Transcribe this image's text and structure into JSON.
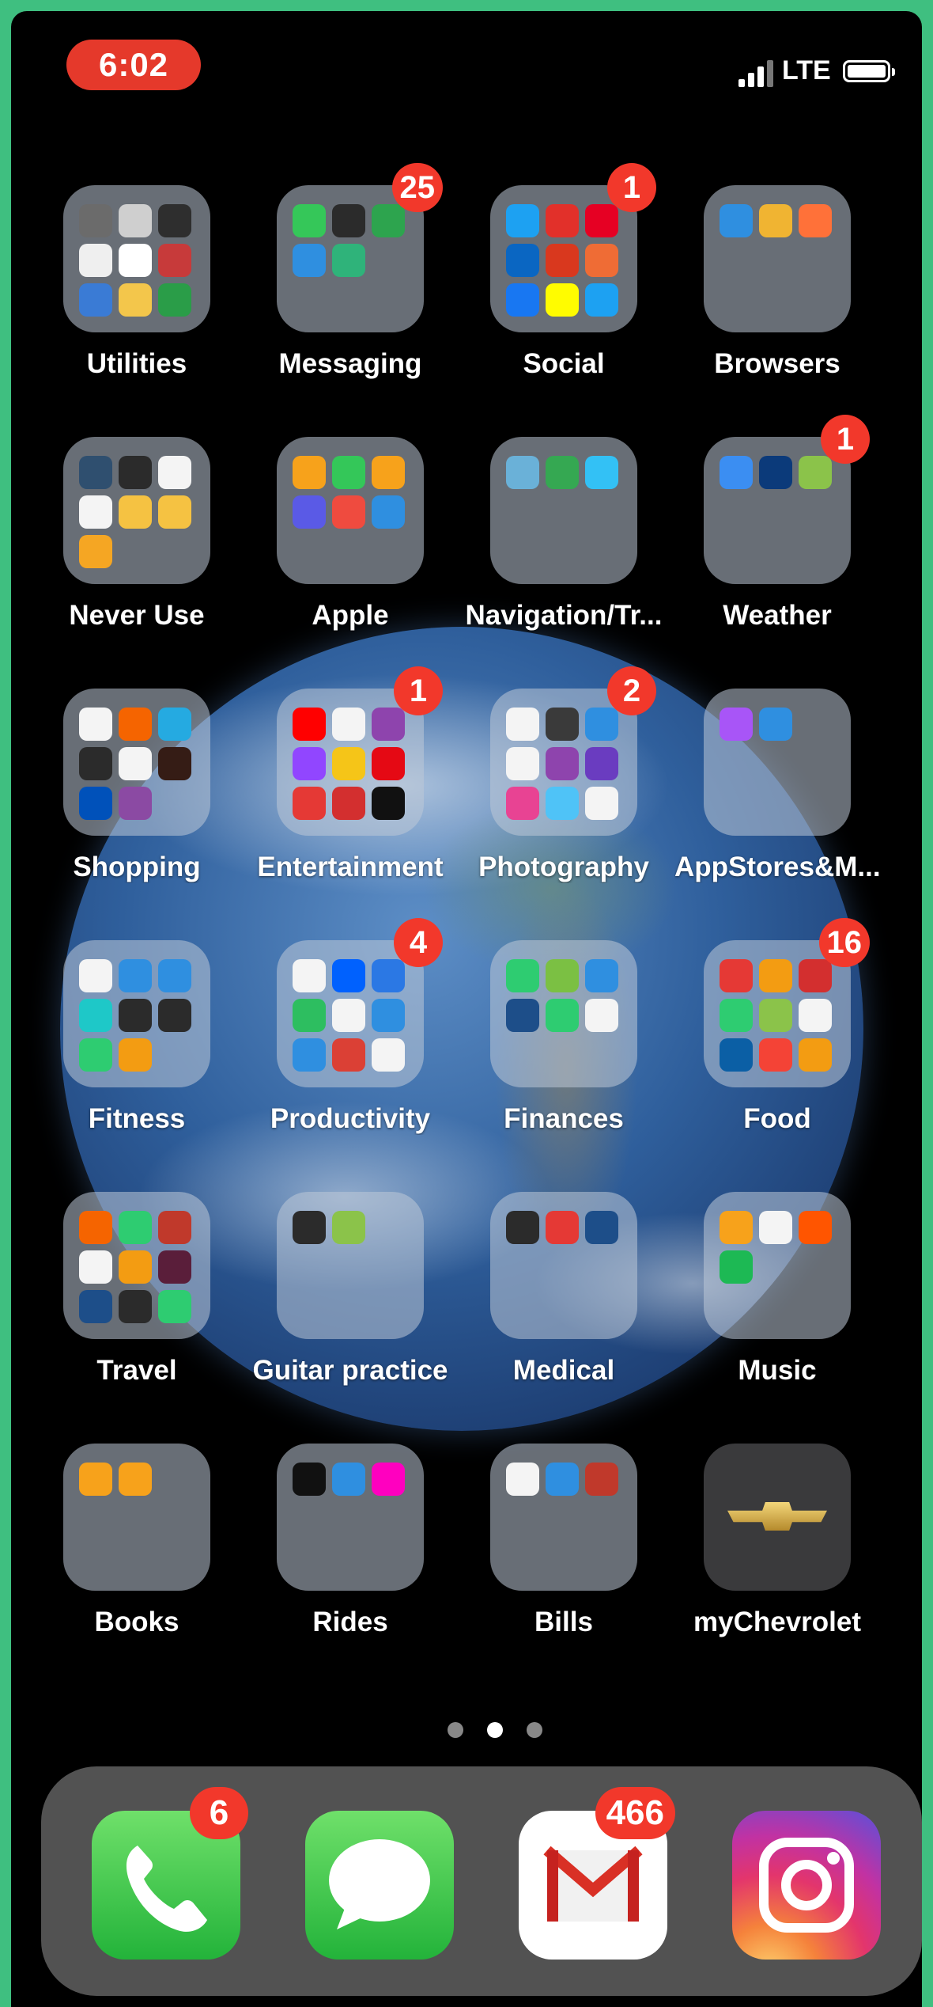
{
  "status_bar": {
    "time": "6:02",
    "carrier": "LTE"
  },
  "folders": [
    {
      "label": "Utilities",
      "badge": "",
      "colors": [
        "#6b6b6b",
        "#cfcfcf",
        "#2e2e2e",
        "#efefef",
        "#ffffff",
        "#c73a3a",
        "#3a7bd5",
        "#f3c64b",
        "#2a9d48"
      ]
    },
    {
      "label": "Messaging",
      "badge": "25",
      "colors": [
        "#35c759",
        "#2b2b2b",
        "#2da44e",
        "#2f8fe0",
        "#2fb37a"
      ]
    },
    {
      "label": "Social",
      "badge": "1",
      "colors": [
        "#1da1f2",
        "#e2302a",
        "#e60023",
        "#0a66c2",
        "#d9381e",
        "#ef6c35",
        "#1877f2",
        "#fffc00",
        "#1da1f2"
      ]
    },
    {
      "label": "Browsers",
      "badge": "",
      "colors": [
        "#2f8fe0",
        "#f0b432",
        "#ff7139"
      ]
    },
    {
      "label": "Never Use",
      "badge": "",
      "colors": [
        "#2f4f6f",
        "#2b2b2b",
        "#f4f4f4",
        "#f4f4f4",
        "#f5c242",
        "#f5c242",
        "#f5a623"
      ]
    },
    {
      "label": "Apple",
      "badge": "",
      "colors": [
        "#f7a21b",
        "#34c759",
        "#f7a21b",
        "#5a5ae6",
        "#ef4b3f",
        "#2f8fe0"
      ]
    },
    {
      "label": "Navigation/Tr...",
      "badge": "",
      "colors": [
        "#6ab1d8",
        "#35a852",
        "#33c1f5"
      ]
    },
    {
      "label": "Weather",
      "badge": "1",
      "colors": [
        "#3b8ef2",
        "#0b3a7a",
        "#8bc34a"
      ]
    },
    {
      "label": "Shopping",
      "badge": "",
      "colors": [
        "#f4f4f4",
        "#f56400",
        "#25aae1",
        "#2b2b2b",
        "#f4f4f4",
        "#351c15",
        "#0051ba",
        "#8b4aa3"
      ]
    },
    {
      "label": "Entertainment",
      "badge": "1",
      "colors": [
        "#ff0000",
        "#f4f4f4",
        "#8e44ad",
        "#9146ff",
        "#f5c518",
        "#e50914",
        "#e53935",
        "#d32f2f",
        "#111111"
      ]
    },
    {
      "label": "Photography",
      "badge": "2",
      "colors": [
        "#f4f4f4",
        "#3a3a3a",
        "#2f8fe0",
        "#f4f4f4",
        "#8e44ad",
        "#6a3cc0",
        "#e84393",
        "#4fc3f7",
        "#f4f4f4"
      ]
    },
    {
      "label": "AppStores&M...",
      "badge": "",
      "colors": [
        "#a855f7",
        "#2f8fe0"
      ]
    },
    {
      "label": "Fitness",
      "badge": "",
      "colors": [
        "#f4f4f4",
        "#2f8fe0",
        "#2f8fe0",
        "#1ec8c8",
        "#2b2b2b",
        "#2b2b2b",
        "#2ecc71",
        "#f39c12"
      ]
    },
    {
      "label": "Productivity",
      "badge": "4",
      "colors": [
        "#f4f4f4",
        "#0061fe",
        "#2b78e4",
        "#2dbe60",
        "#f4f4f4",
        "#2f8fe0",
        "#2f8fe0",
        "#db4035",
        "#f4f4f4"
      ]
    },
    {
      "label": "Finances",
      "badge": "",
      "colors": [
        "#2ecc71",
        "#7bc043",
        "#2f8fe0",
        "#1d4e89",
        "#2ecc71",
        "#f4f4f4"
      ]
    },
    {
      "label": "Food",
      "badge": "16",
      "colors": [
        "#e53935",
        "#f39c12",
        "#d32f2f",
        "#2ecc71",
        "#8bc34a",
        "#f4f4f4",
        "#0b5fa5",
        "#f44336",
        "#f39c12"
      ]
    },
    {
      "label": "Travel",
      "badge": "",
      "colors": [
        "#f56400",
        "#2ecc71",
        "#c0392b",
        "#f4f4f4",
        "#f39c12",
        "#5a1e3a",
        "#1d4e89",
        "#2b2b2b",
        "#2ecc71"
      ]
    },
    {
      "label": "Guitar practice",
      "badge": "",
      "colors": [
        "#2b2b2b",
        "#8bc34a"
      ]
    },
    {
      "label": "Medical",
      "badge": "",
      "colors": [
        "#2b2b2b",
        "#e53935",
        "#1d4e89"
      ]
    },
    {
      "label": "Music",
      "badge": "",
      "colors": [
        "#f7a21b",
        "#f4f4f4",
        "#ff5500",
        "#1db954"
      ]
    },
    {
      "label": "Books",
      "badge": "",
      "colors": [
        "#f7a21b",
        "#f7a21b"
      ]
    },
    {
      "label": "Rides",
      "badge": "",
      "colors": [
        "#111111",
        "#2f8fe0",
        "#ff00bf"
      ]
    },
    {
      "label": "Bills",
      "badge": "",
      "colors": [
        "#f4f4f4",
        "#2f8fe0",
        "#c0392b"
      ]
    }
  ],
  "apps": [
    {
      "label": "myChevrolet",
      "badge": ""
    }
  ],
  "page_dots": {
    "count": 3,
    "active": 1
  },
  "dock": [
    {
      "name": "Phone",
      "badge": "6"
    },
    {
      "name": "Messages",
      "badge": ""
    },
    {
      "name": "Gmail",
      "badge": "466"
    },
    {
      "name": "Instagram",
      "badge": ""
    }
  ]
}
